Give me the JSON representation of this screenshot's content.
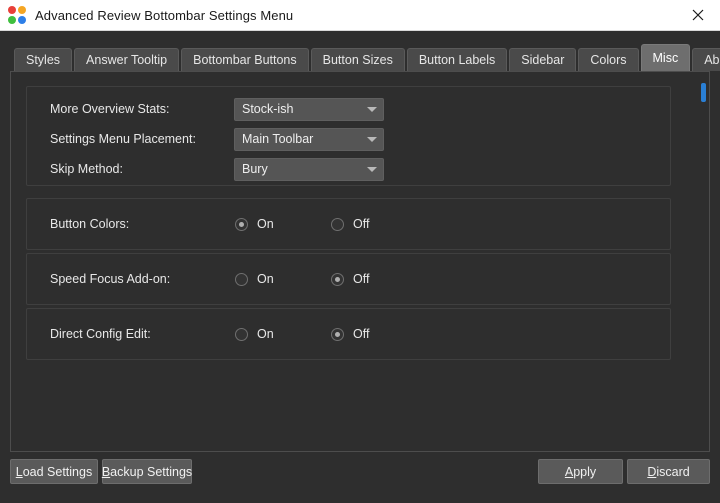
{
  "window": {
    "title": "Advanced Review Bottombar Settings Menu",
    "icon": "anki-dots-icon",
    "close_label": "close-icon"
  },
  "tabs": [
    {
      "label": "Styles",
      "active": false
    },
    {
      "label": "Answer Tooltip",
      "active": false
    },
    {
      "label": "Bottombar Buttons",
      "active": false
    },
    {
      "label": "Button Sizes",
      "active": false
    },
    {
      "label": "Button Labels",
      "active": false
    },
    {
      "label": "Sidebar",
      "active": false
    },
    {
      "label": "Colors",
      "active": false
    },
    {
      "label": "Misc",
      "active": true
    },
    {
      "label": "About",
      "active": false
    }
  ],
  "misc": {
    "selects": [
      {
        "label": "More Overview Stats:",
        "value": "Stock-ish"
      },
      {
        "label": "Settings Menu Placement:",
        "value": "Main Toolbar"
      },
      {
        "label": "Skip Method:",
        "value": "Bury"
      }
    ],
    "toggles": [
      {
        "label": "Button Colors:",
        "on_label": "On",
        "off_label": "Off",
        "selected": "On"
      },
      {
        "label": "Speed Focus Add-on:",
        "on_label": "On",
        "off_label": "Off",
        "selected": "Off"
      },
      {
        "label": "Direct Config Edit:",
        "on_label": "On",
        "off_label": "Off",
        "selected": "Off"
      }
    ]
  },
  "buttons": {
    "load": {
      "accel": "L",
      "rest": "oad Settings"
    },
    "backup": {
      "accel": "B",
      "rest": "ackup Settings"
    },
    "apply": {
      "accel": "A",
      "rest": "pply"
    },
    "discard": {
      "accel": "D",
      "rest": "iscard"
    }
  },
  "colors": {
    "window_bg": "#2e2e2e",
    "titlebar_bg": "#ffffff",
    "tab_bg": "#4a4a4a",
    "tab_active_bg": "#6e6e6e",
    "combo_bg": "#555555",
    "button_bg": "#5a5a5a",
    "scrollbar_thumb": "#2a7fd4",
    "text": "#e8e8e8"
  },
  "scrollbar": {
    "thumb_color": "#2a7fd4"
  }
}
